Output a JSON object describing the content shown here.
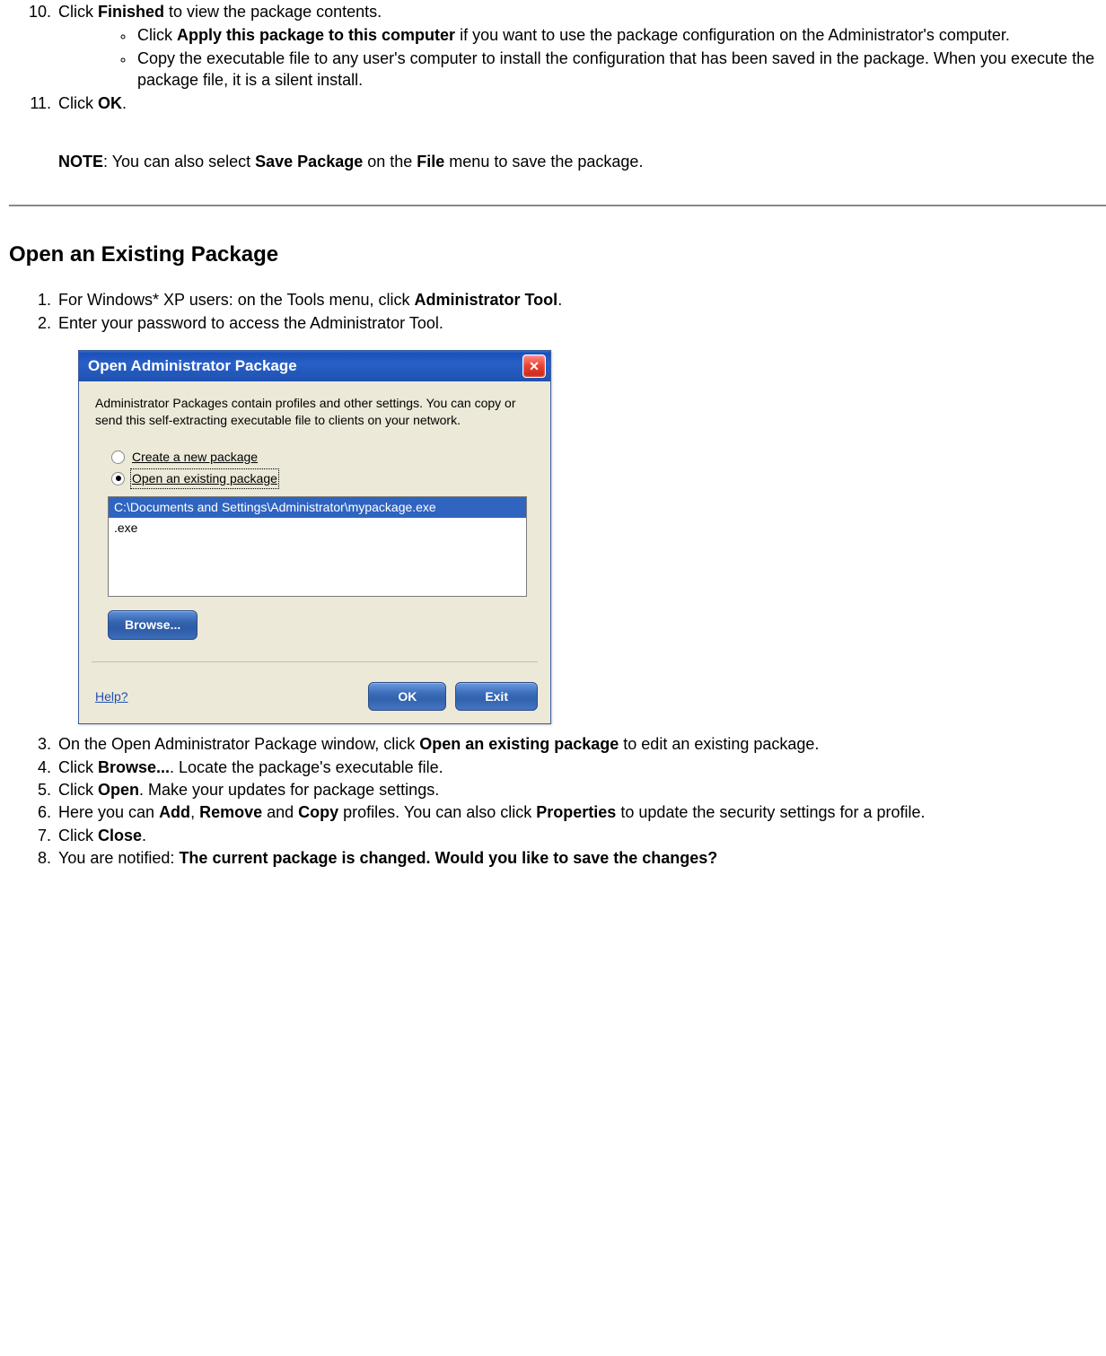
{
  "section1": {
    "step10": {
      "prefix": "Click ",
      "bold": "Finished",
      "suffix": " to view the package contents."
    },
    "bullets": [
      {
        "prefix": "Click ",
        "bold": "Apply this package to this computer",
        "suffix": " if you want to use the package configuration on the Administrator's computer."
      },
      {
        "text": "Copy the executable file to any user's computer to install the configuration that has been saved in the package. When you execute the package file, it is a silent install."
      }
    ],
    "step11": {
      "prefix": "Click ",
      "bold": "OK",
      "suffix": "."
    },
    "note": {
      "label": "NOTE",
      "text1": ": You can also select ",
      "bold1": "Save Package",
      "text2": " on the ",
      "bold2": "File",
      "text3": " menu to save the package."
    }
  },
  "heading": "Open an Existing Package",
  "section2": {
    "step1": {
      "prefix": "For Windows* XP users: on the Tools menu, click ",
      "bold": "Administrator Tool",
      "suffix": "."
    },
    "step2": "Enter your password to access the Administrator Tool.",
    "step3": {
      "prefix": "On the Open Administrator Package window, click ",
      "bold": "Open an existing package",
      "suffix": " to edit an existing package."
    },
    "step4": {
      "prefix": "Click ",
      "bold": "Browse...",
      "suffix": ". Locate the package's executable file."
    },
    "step5": {
      "prefix": "Click ",
      "bold": "Open",
      "suffix": ". Make your updates for package settings."
    },
    "step6": {
      "prefix": "Here you can ",
      "bold1": "Add",
      "mid1": ", ",
      "bold2": "Remove",
      "mid2": " and ",
      "bold3": "Copy",
      "mid3": " profiles. You can also click ",
      "bold4": "Properties",
      "suffix": " to update the security settings for a profile."
    },
    "step7": {
      "prefix": "Click ",
      "bold": "Close",
      "suffix": "."
    },
    "step8": {
      "prefix": "You are notified: ",
      "bold": "The current package is changed. Would you like to save the changes?"
    }
  },
  "dialog": {
    "title": "Open Administrator Package",
    "description": "Administrator Packages contain profiles and other settings. You can copy or send this self-extracting executable file to clients on your network.",
    "radio1": "Create a new package",
    "radio2": "Open an existing package",
    "file_selected": "C:\\Documents and Settings\\Administrator\\mypackage.exe",
    "file_other": ".exe",
    "browse_label": "Browse...",
    "help_label": "Help?",
    "ok_label": "OK",
    "exit_label": "Exit"
  }
}
